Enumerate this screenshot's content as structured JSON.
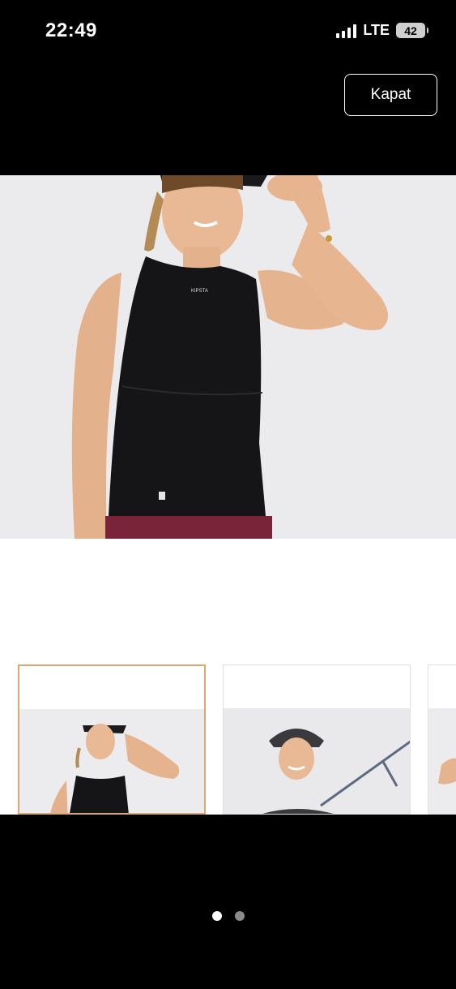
{
  "status_bar": {
    "time": "22:49",
    "network": "LTE",
    "battery": "42"
  },
  "close_button": {
    "label": "Kapat"
  },
  "product": {
    "main_image": "product-photo-woman-black-sleeveless-top",
    "thumbnails": [
      {
        "image": "woman-visor-black-tank-top",
        "selected": true
      },
      {
        "image": "woman-visor-closeup-tennis-court",
        "selected": false
      },
      {
        "image": "partial-thumbnail",
        "selected": false
      }
    ]
  },
  "pagination": {
    "total": 2,
    "active": 1
  },
  "colors": {
    "selected_border": "#d9a873",
    "background": "#000000",
    "photo_background": "#ebebee"
  }
}
